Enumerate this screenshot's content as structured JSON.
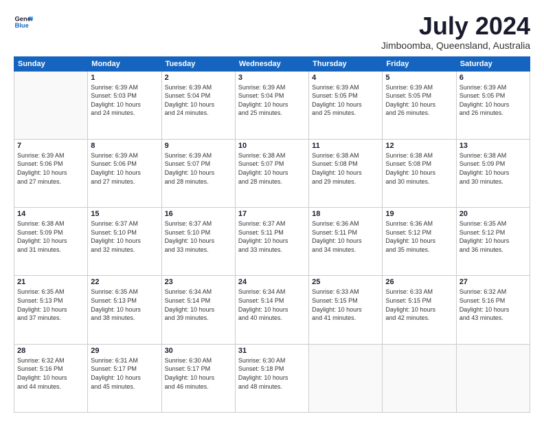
{
  "logo": {
    "line1": "General",
    "line2": "Blue"
  },
  "title": "July 2024",
  "location": "Jimboomba, Queensland, Australia",
  "days_of_week": [
    "Sunday",
    "Monday",
    "Tuesday",
    "Wednesday",
    "Thursday",
    "Friday",
    "Saturday"
  ],
  "weeks": [
    [
      {
        "day": "",
        "info": ""
      },
      {
        "day": "1",
        "info": "Sunrise: 6:39 AM\nSunset: 5:03 PM\nDaylight: 10 hours\nand 24 minutes."
      },
      {
        "day": "2",
        "info": "Sunrise: 6:39 AM\nSunset: 5:04 PM\nDaylight: 10 hours\nand 24 minutes."
      },
      {
        "day": "3",
        "info": "Sunrise: 6:39 AM\nSunset: 5:04 PM\nDaylight: 10 hours\nand 25 minutes."
      },
      {
        "day": "4",
        "info": "Sunrise: 6:39 AM\nSunset: 5:05 PM\nDaylight: 10 hours\nand 25 minutes."
      },
      {
        "day": "5",
        "info": "Sunrise: 6:39 AM\nSunset: 5:05 PM\nDaylight: 10 hours\nand 26 minutes."
      },
      {
        "day": "6",
        "info": "Sunrise: 6:39 AM\nSunset: 5:05 PM\nDaylight: 10 hours\nand 26 minutes."
      }
    ],
    [
      {
        "day": "7",
        "info": "Sunrise: 6:39 AM\nSunset: 5:06 PM\nDaylight: 10 hours\nand 27 minutes."
      },
      {
        "day": "8",
        "info": "Sunrise: 6:39 AM\nSunset: 5:06 PM\nDaylight: 10 hours\nand 27 minutes."
      },
      {
        "day": "9",
        "info": "Sunrise: 6:39 AM\nSunset: 5:07 PM\nDaylight: 10 hours\nand 28 minutes."
      },
      {
        "day": "10",
        "info": "Sunrise: 6:38 AM\nSunset: 5:07 PM\nDaylight: 10 hours\nand 28 minutes."
      },
      {
        "day": "11",
        "info": "Sunrise: 6:38 AM\nSunset: 5:08 PM\nDaylight: 10 hours\nand 29 minutes."
      },
      {
        "day": "12",
        "info": "Sunrise: 6:38 AM\nSunset: 5:08 PM\nDaylight: 10 hours\nand 30 minutes."
      },
      {
        "day": "13",
        "info": "Sunrise: 6:38 AM\nSunset: 5:09 PM\nDaylight: 10 hours\nand 30 minutes."
      }
    ],
    [
      {
        "day": "14",
        "info": "Sunrise: 6:38 AM\nSunset: 5:09 PM\nDaylight: 10 hours\nand 31 minutes."
      },
      {
        "day": "15",
        "info": "Sunrise: 6:37 AM\nSunset: 5:10 PM\nDaylight: 10 hours\nand 32 minutes."
      },
      {
        "day": "16",
        "info": "Sunrise: 6:37 AM\nSunset: 5:10 PM\nDaylight: 10 hours\nand 33 minutes."
      },
      {
        "day": "17",
        "info": "Sunrise: 6:37 AM\nSunset: 5:11 PM\nDaylight: 10 hours\nand 33 minutes."
      },
      {
        "day": "18",
        "info": "Sunrise: 6:36 AM\nSunset: 5:11 PM\nDaylight: 10 hours\nand 34 minutes."
      },
      {
        "day": "19",
        "info": "Sunrise: 6:36 AM\nSunset: 5:12 PM\nDaylight: 10 hours\nand 35 minutes."
      },
      {
        "day": "20",
        "info": "Sunrise: 6:35 AM\nSunset: 5:12 PM\nDaylight: 10 hours\nand 36 minutes."
      }
    ],
    [
      {
        "day": "21",
        "info": "Sunrise: 6:35 AM\nSunset: 5:13 PM\nDaylight: 10 hours\nand 37 minutes."
      },
      {
        "day": "22",
        "info": "Sunrise: 6:35 AM\nSunset: 5:13 PM\nDaylight: 10 hours\nand 38 minutes."
      },
      {
        "day": "23",
        "info": "Sunrise: 6:34 AM\nSunset: 5:14 PM\nDaylight: 10 hours\nand 39 minutes."
      },
      {
        "day": "24",
        "info": "Sunrise: 6:34 AM\nSunset: 5:14 PM\nDaylight: 10 hours\nand 40 minutes."
      },
      {
        "day": "25",
        "info": "Sunrise: 6:33 AM\nSunset: 5:15 PM\nDaylight: 10 hours\nand 41 minutes."
      },
      {
        "day": "26",
        "info": "Sunrise: 6:33 AM\nSunset: 5:15 PM\nDaylight: 10 hours\nand 42 minutes."
      },
      {
        "day": "27",
        "info": "Sunrise: 6:32 AM\nSunset: 5:16 PM\nDaylight: 10 hours\nand 43 minutes."
      }
    ],
    [
      {
        "day": "28",
        "info": "Sunrise: 6:32 AM\nSunset: 5:16 PM\nDaylight: 10 hours\nand 44 minutes."
      },
      {
        "day": "29",
        "info": "Sunrise: 6:31 AM\nSunset: 5:17 PM\nDaylight: 10 hours\nand 45 minutes."
      },
      {
        "day": "30",
        "info": "Sunrise: 6:30 AM\nSunset: 5:17 PM\nDaylight: 10 hours\nand 46 minutes."
      },
      {
        "day": "31",
        "info": "Sunrise: 6:30 AM\nSunset: 5:18 PM\nDaylight: 10 hours\nand 48 minutes."
      },
      {
        "day": "",
        "info": ""
      },
      {
        "day": "",
        "info": ""
      },
      {
        "day": "",
        "info": ""
      }
    ]
  ]
}
